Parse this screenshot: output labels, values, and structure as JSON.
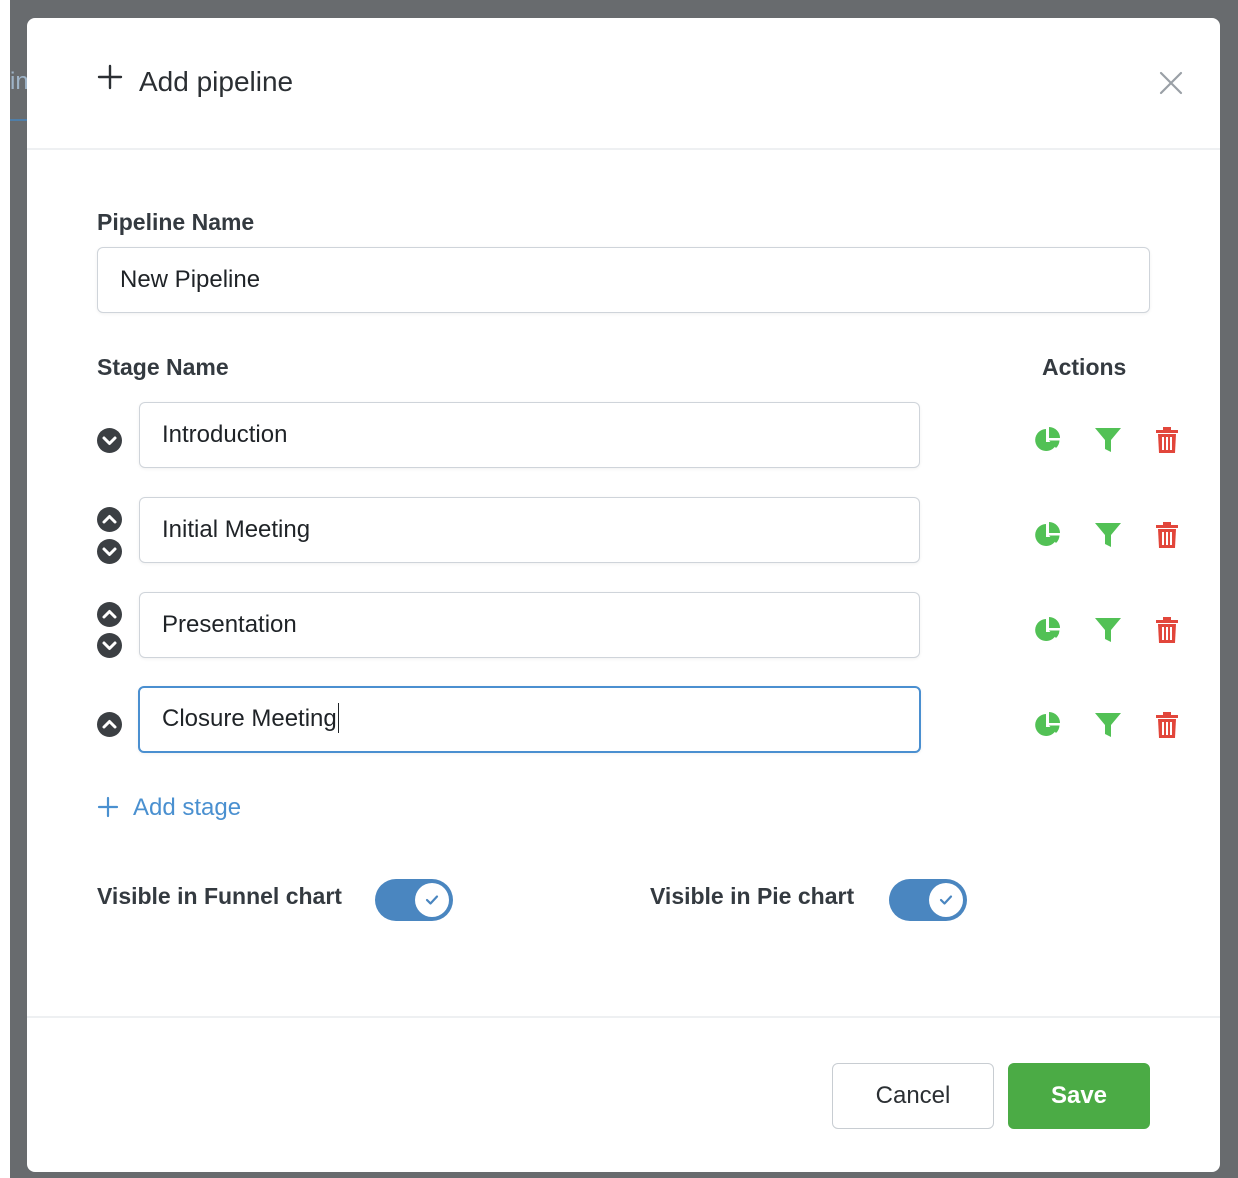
{
  "header": {
    "title": "Add pipeline",
    "plus_icon": "plus-icon",
    "close_icon": "close-icon"
  },
  "background": {
    "partial_tab_text": "in"
  },
  "form": {
    "pipeline_name_label": "Pipeline Name",
    "pipeline_name_value": "New Pipeline",
    "stage_name_label": "Stage Name",
    "actions_label": "Actions",
    "stages": [
      {
        "name": "Introduction",
        "can_move_up": false,
        "can_move_down": true
      },
      {
        "name": "Initial Meeting",
        "can_move_up": true,
        "can_move_down": true
      },
      {
        "name": "Presentation",
        "can_move_up": true,
        "can_move_down": true
      },
      {
        "name": "Closure Meeting",
        "can_move_up": true,
        "can_move_down": false,
        "focused": true
      }
    ],
    "stage_action_icons": [
      "pie-chart-icon",
      "filter-icon",
      "trash-icon"
    ],
    "add_stage_label": "Add stage",
    "funnel_toggle": {
      "label": "Visible in Funnel chart",
      "checked": true
    },
    "pie_toggle": {
      "label": "Visible in Pie chart",
      "checked": true
    }
  },
  "footer": {
    "cancel_label": "Cancel",
    "save_label": "Save"
  },
  "colors": {
    "accent_blue": "#4a8fd0",
    "action_green": "#52c155",
    "delete_red": "#e2463b",
    "save_green": "#4bab45",
    "toggle_blue": "#4a86c0",
    "backdrop": "#686b6e"
  }
}
